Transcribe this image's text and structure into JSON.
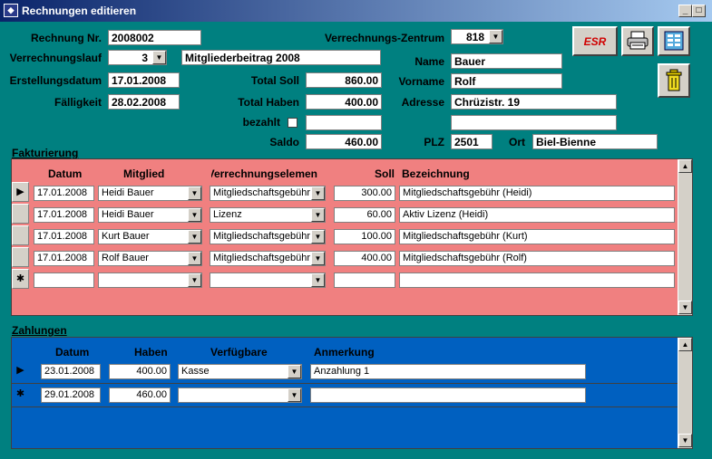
{
  "window": {
    "title": "Rechnungen editieren",
    "controls": {
      "minimize": "_",
      "maximize": "□",
      "close": "×"
    }
  },
  "header": {
    "rechnung_label": "Rechnung Nr.",
    "rechnung_value": "2008002",
    "zentrum_label": "Verrechnungs-Zentrum",
    "zentrum_value": "818",
    "lauf_label": "Verrechnungslauf",
    "lauf_value": "3",
    "lauf_desc": "Mitgliederbeitrag 2008",
    "erstellung_label": "Erstellungsdatum",
    "erstellung_value": "17.01.2008",
    "faelligkeit_label": "Fälligkeit",
    "faelligkeit_value": "28.02.2008",
    "soll_label": "Total Soll",
    "soll_value": "860.00",
    "haben_label": "Total Haben",
    "haben_value": "400.00",
    "bezahlt_label": "bezahlt",
    "saldo_label": "Saldo",
    "saldo_value": "460.00",
    "name_label": "Name",
    "name_value": "Bauer",
    "vorname_label": "Vorname",
    "vorname_value": "Rolf",
    "adresse_label": "Adresse",
    "adresse_value": "Chrüzistr. 19",
    "adresse2_value": "",
    "plz_label": "PLZ",
    "plz_value": "2501",
    "ort_label": "Ort",
    "ort_value": "Biel-Bienne"
  },
  "toolbar": {
    "esr_label": "ESR"
  },
  "fakturierung": {
    "title": "Fakturierung",
    "columns": [
      "Datum",
      "Mitglied",
      "Verrechnungselemen",
      "Soll",
      "Bezeichnung"
    ],
    "rows": [
      {
        "selector": "▶",
        "datum": "17.01.2008",
        "mitglied": "Heidi Bauer",
        "element": "Mitgliedschaftsgebühr",
        "soll": "300.00",
        "bezeichnung": "Mitgliedschaftsgebühr (Heidi)"
      },
      {
        "selector": "",
        "datum": "17.01.2008",
        "mitglied": "Heidi Bauer",
        "element": "Lizenz",
        "soll": "60.00",
        "bezeichnung": "Aktiv Lizenz (Heidi)"
      },
      {
        "selector": "",
        "datum": "17.01.2008",
        "mitglied": "Kurt Bauer",
        "element": "Mitgliedschaftsgebühr",
        "soll": "100.00",
        "bezeichnung": "Mitgliedschaftsgebühr (Kurt)"
      },
      {
        "selector": "",
        "datum": "17.01.2008",
        "mitglied": "Rolf Bauer",
        "element": "Mitgliedschaftsgebühr",
        "soll": "400.00",
        "bezeichnung": "Mitgliedschaftsgebühr (Rolf)"
      },
      {
        "selector": "✱",
        "datum": "",
        "mitglied": "",
        "element": "",
        "soll": "",
        "bezeichnung": ""
      }
    ]
  },
  "zahlungen": {
    "title": "Zahlungen",
    "columns": [
      "Datum",
      "Haben",
      "Verfügbare",
      "Anmerkung"
    ],
    "rows": [
      {
        "selector": "▶",
        "datum": "23.01.2008",
        "haben": "400.00",
        "verfuegbare": "Kasse",
        "anmerkung": "Anzahlung 1"
      },
      {
        "selector": "✱",
        "datum": "29.01.2008",
        "haben": "460.00",
        "verfuegbare": "",
        "anmerkung": ""
      }
    ]
  },
  "colors": {
    "background": "#008080",
    "fakturierung": "#f08080",
    "zahlungen": "#0060c0",
    "title_bar": "#0a246a"
  }
}
